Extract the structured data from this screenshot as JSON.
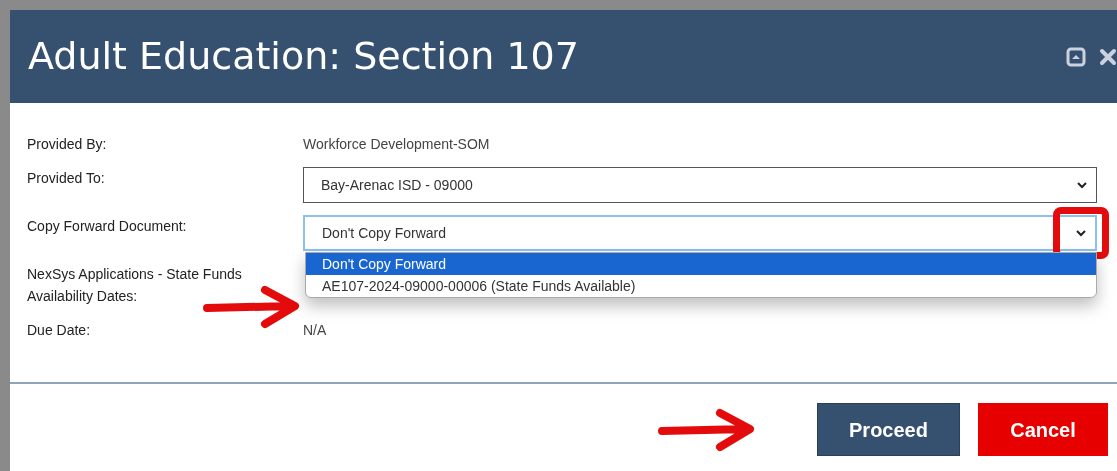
{
  "dialog": {
    "title": "Adult Education: Section 107",
    "fields": [
      {
        "kind": "text",
        "label": "Provided By:",
        "value": "Workforce Development-SOM"
      },
      {
        "kind": "select",
        "label": "Provided To:",
        "value": "Bay-Arenac ISD - 09000",
        "expanded": false
      },
      {
        "kind": "select",
        "label": "Copy Forward Document:",
        "value": "Don't Copy Forward",
        "expanded": true,
        "options": [
          {
            "label": "Don't Copy Forward",
            "selected": true
          },
          {
            "label": "AE107-2024-09000-00006 (State Funds Available)",
            "selected": false
          }
        ]
      },
      {
        "kind": "text",
        "label": "NexSys Applications - State Funds Availability Dates:"
      },
      {
        "kind": "text",
        "label": "Due Date:",
        "value": "N/A"
      }
    ],
    "buttons": [
      {
        "label": "Proceed",
        "kind": "primary"
      },
      {
        "label": "Cancel",
        "kind": "danger"
      }
    ]
  }
}
